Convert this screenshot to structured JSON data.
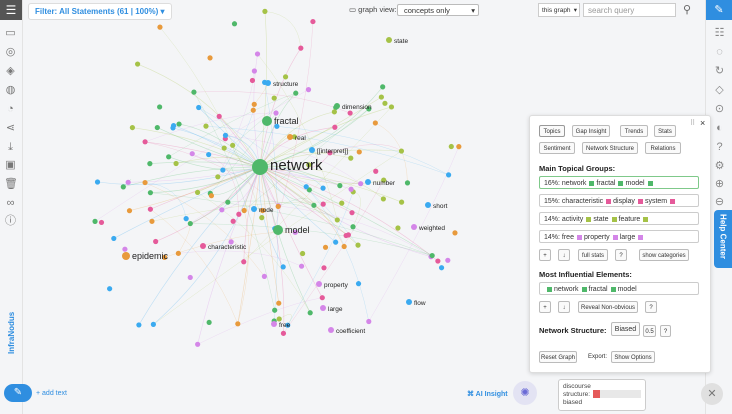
{
  "toolbar": {
    "filter_label": "Filter: All Statements (61 | 100%)",
    "graph_view_label": "graph view:",
    "graph_view_select": "concepts only",
    "scope_select": "this graph",
    "search_placeholder": "search query"
  },
  "left_icons": [
    "menu-icon",
    "comment-icon",
    "layers-icon",
    "layers-alt-icon",
    "palette-icon",
    "history-icon",
    "share-icon",
    "download-icon",
    "save-icon",
    "trash-icon",
    "link-icon",
    "info-icon"
  ],
  "right_icons": [
    "chat-icon",
    "list-icon",
    "circle-icon",
    "refresh-icon",
    "diamond-icon",
    "target-icon",
    "contrast-icon",
    "help-icon",
    "settings-icon",
    "zoom-in-icon",
    "zoom-out-icon"
  ],
  "brand": "InfraNodus",
  "help_center": "Help Center",
  "graph": {
    "labels": [
      {
        "t": "network",
        "size": "big"
      },
      {
        "t": "fractal",
        "size": "med"
      },
      {
        "t": "model",
        "size": "med"
      },
      {
        "t": "epidemic",
        "size": "med"
      },
      {
        "t": "structure",
        "size": "sm"
      },
      {
        "t": "dimension",
        "size": "sm"
      },
      {
        "t": "real",
        "size": "sm"
      },
      {
        "t": "[[interpret]]",
        "size": "sm"
      },
      {
        "t": "number",
        "size": "sm"
      },
      {
        "t": "short",
        "size": "sm"
      },
      {
        "t": "weighted",
        "size": "sm"
      },
      {
        "t": "node",
        "size": "sm"
      },
      {
        "t": "characteristic",
        "size": "sm"
      },
      {
        "t": "property",
        "size": "sm"
      },
      {
        "t": "large",
        "size": "sm"
      },
      {
        "t": "free",
        "size": "sm"
      },
      {
        "t": "coefficient",
        "size": "sm"
      },
      {
        "t": "flow",
        "size": "sm"
      },
      {
        "t": "state",
        "size": "sm"
      }
    ]
  },
  "panel": {
    "tabs": [
      "Topics",
      "Gap Insight",
      "Trends",
      "Stats",
      "Sentiment",
      "Network Structure",
      "Relations"
    ],
    "main_groups_title": "Main Topical Groups:",
    "groups": [
      {
        "pct": "16%:",
        "words": [
          "network",
          "fractal",
          "model"
        ],
        "color": "#4fb86a"
      },
      {
        "pct": "15%:",
        "words": [
          "characteristic",
          "display",
          "system"
        ],
        "color": "#e55a9a"
      },
      {
        "pct": "14%:",
        "words": [
          "activity",
          "state",
          "feature"
        ],
        "color": "#a5c247"
      },
      {
        "pct": "14%:",
        "words": [
          "free",
          "property",
          "large"
        ],
        "color": "#d486e8"
      }
    ],
    "plus_label": "+",
    "down_label": "↓",
    "full_stats_label": "full stats",
    "question_label": "?",
    "show_categories_label": "show categories",
    "influential_title": "Most Influential Elements:",
    "influential_words": [
      "network",
      "fractal",
      "model"
    ],
    "reveal_label": "Reveal Non-obvious",
    "structure_title": "Network Structure:",
    "structure_value": "Biased",
    "structure_score": "0.5",
    "reset_label": "Reset Graph",
    "export_label": "Export:",
    "show_options_label": "Show Options",
    "close_label": "×",
    "drag_label": "⠿"
  },
  "bottom": {
    "add_text_label": "+ add text",
    "ai_insight_label": "⌘ AI Insight",
    "discourse_label_1": "discourse",
    "discourse_label_2": "structure:",
    "discourse_value": "biased",
    "discourse_level": 0.15
  },
  "colors": {
    "accent": "#2f8ee0",
    "green": "#4fb86a",
    "pink": "#e55a9a",
    "olive": "#a5c247",
    "purple": "#d486e8",
    "blue": "#3aaaf0",
    "orange": "#e89a3c"
  }
}
